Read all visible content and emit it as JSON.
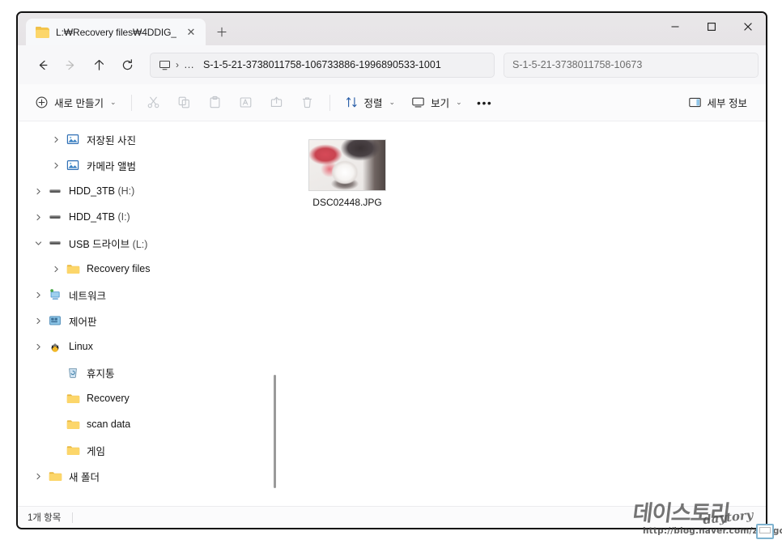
{
  "window": {
    "tab_title": "L:₩Recovery files₩4DDIG_",
    "close_tab_label": "✕",
    "new_tab_label": "＋",
    "minimize_label": "—",
    "maximize_label": "□",
    "close_label": "✕"
  },
  "nav": {
    "back": "←",
    "forward": "→",
    "up": "↑",
    "refresh": "⟳"
  },
  "address": {
    "separator": "›",
    "overflow": "…",
    "path_text": "S-1-5-21-3738011758-106733886-1996890533-1001"
  },
  "search": {
    "value": "S-1-5-21-3738011758-10673"
  },
  "toolbar": {
    "new_label": "새로 만들기",
    "cut_label": "잘라내기",
    "copy_label": "복사",
    "paste_label": "붙여넣기",
    "rename_label": "이름 바꾸기",
    "share_label": "공유",
    "delete_label": "삭제",
    "sort_label": "정렬",
    "view_label": "보기",
    "more_label": "•••",
    "details_label": "세부 정보",
    "chevron": "⌄"
  },
  "sidebar": {
    "items": [
      {
        "label": "저장된 사진",
        "icon": "picture-icon",
        "indent": 2,
        "twisty": "collapsed"
      },
      {
        "label": "카메라 앨범",
        "icon": "picture-icon",
        "indent": 2,
        "twisty": "collapsed"
      },
      {
        "label": "HDD_3TB",
        "drive": "(H:)",
        "icon": "drive-icon",
        "indent": 1,
        "twisty": "collapsed"
      },
      {
        "label": "HDD_4TB",
        "drive": "(I:)",
        "icon": "drive-icon",
        "indent": 1,
        "twisty": "collapsed"
      },
      {
        "label": "USB 드라이브",
        "drive": "(L:)",
        "icon": "drive-icon",
        "indent": 1,
        "twisty": "expanded"
      },
      {
        "label": "Recovery files",
        "icon": "folder-icon",
        "indent": 2,
        "twisty": "collapsed"
      },
      {
        "label": "네트워크",
        "icon": "network-icon",
        "indent": 1,
        "twisty": "collapsed"
      },
      {
        "label": "제어판",
        "icon": "controlpanel-icon",
        "indent": 1,
        "twisty": "collapsed"
      },
      {
        "label": "Linux",
        "icon": "linux-icon",
        "indent": 1,
        "twisty": "collapsed"
      },
      {
        "label": "휴지통",
        "icon": "recyclebin-icon",
        "indent": 2,
        "twisty": "none"
      },
      {
        "label": "Recovery",
        "icon": "folder-icon",
        "indent": 2,
        "twisty": "none"
      },
      {
        "label": "scan data",
        "icon": "folder-icon",
        "indent": 2,
        "twisty": "none"
      },
      {
        "label": "게임",
        "icon": "folder-icon",
        "indent": 2,
        "twisty": "none"
      },
      {
        "label": "새 폴더",
        "icon": "folder-icon",
        "indent": 2,
        "twisty": "collapsed"
      }
    ]
  },
  "content": {
    "files": [
      {
        "name": "DSC02448.JPG",
        "type": "image-thumbnail"
      }
    ]
  },
  "status": {
    "item_count": "1개 항목"
  },
  "watermark": {
    "main": "데이스토리",
    "script": "daytory",
    "url": "http://blog.naver.com/zestgo"
  },
  "colors": {
    "titlebar": "#e7e4e6",
    "navbar": "#f7f7f9",
    "toolbar": "#fbfbfc",
    "folder_yellow": "#fcd66a",
    "accent_blue": "#3a7dd0",
    "disabled": "#c2c6cb"
  }
}
